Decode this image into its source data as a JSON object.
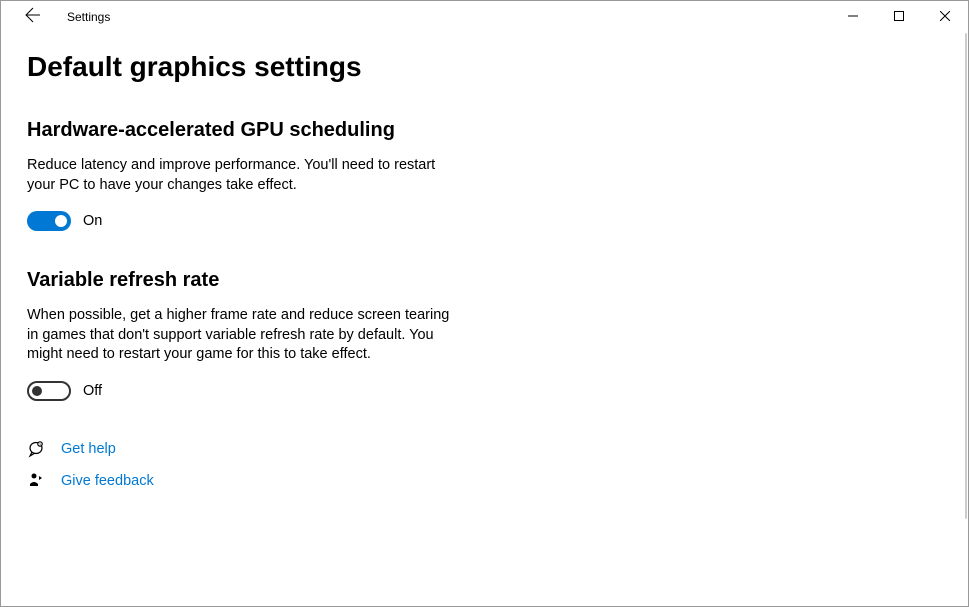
{
  "window": {
    "app_title": "Settings"
  },
  "page": {
    "title": "Default graphics settings"
  },
  "sections": {
    "gpu_scheduling": {
      "header": "Hardware-accelerated GPU scheduling",
      "description": "Reduce latency and improve performance. You'll need to restart your PC to have your changes take effect.",
      "toggle_state": "on",
      "toggle_label": "On"
    },
    "variable_refresh": {
      "header": "Variable refresh rate",
      "description": "When possible, get a higher frame rate and reduce screen tearing in games that don't support variable refresh rate by default. You might need to restart your game for this to take effect.",
      "toggle_state": "off",
      "toggle_label": "Off"
    }
  },
  "links": {
    "get_help": "Get help",
    "give_feedback": "Give feedback"
  }
}
